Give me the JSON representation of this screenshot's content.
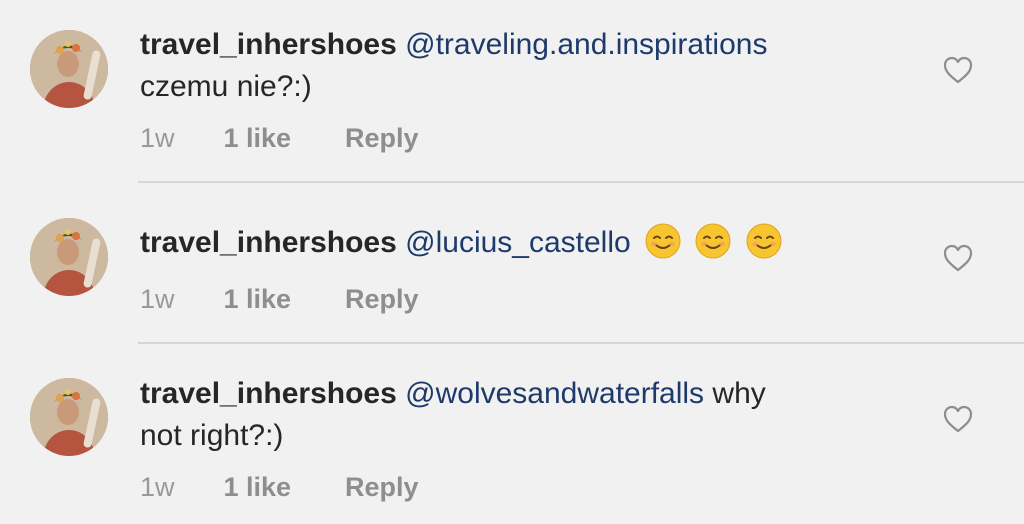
{
  "comments": [
    {
      "username": "travel_inhershoes",
      "mention": "@traveling.and.inspirations",
      "text_after": "",
      "second_line": "czemu nie?:)",
      "time": "1w",
      "likes": "1 like",
      "reply": "Reply",
      "emoji_count": 0
    },
    {
      "username": "travel_inhershoes",
      "mention": "@lucius_castello",
      "text_after": "",
      "second_line": "",
      "time": "1w",
      "likes": "1 like",
      "reply": "Reply",
      "emoji_count": 3,
      "emoji_name": "smiling-face-icon"
    },
    {
      "username": "travel_inhershoes",
      "mention": "@wolvesandwaterfalls",
      "text_after": " why",
      "second_line": "not right?:)",
      "time": "1w",
      "likes": "1 like",
      "reply": "Reply",
      "emoji_count": 0
    }
  ],
  "colors": {
    "background": "#f1f1f1",
    "text": "#262626",
    "mention": "#1e3a6b",
    "meta": "#999999",
    "divider": "#d6d6d6"
  },
  "icons": {
    "like": "heart-outline-icon",
    "avatar": "profile-photo"
  }
}
